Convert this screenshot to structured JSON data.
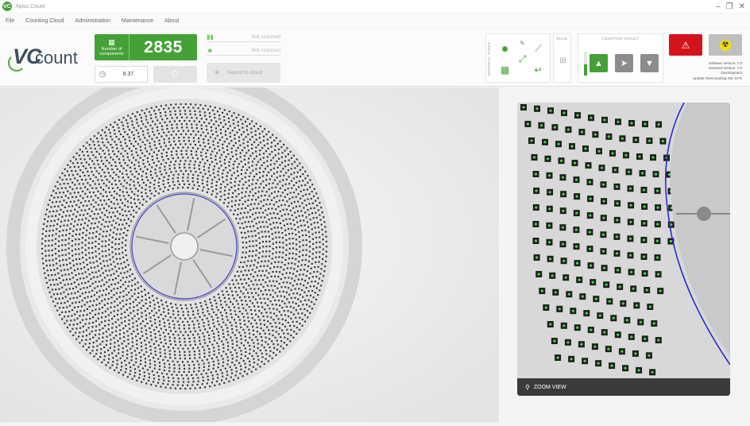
{
  "window": {
    "title": "Xpiss Count",
    "app_icon": "VC",
    "controls": [
      "minimize-icon",
      "restore-icon",
      "close-icon"
    ]
  },
  "menu": [
    "File",
    "Counting Cloud",
    "Administration",
    "Maintenance",
    "About"
  ],
  "logo": {
    "vc": "VC",
    "count": "count"
  },
  "counter": {
    "label": "Number of components",
    "value": "2835",
    "accent": "#43a136"
  },
  "timer": {
    "value": "8.37",
    "icon": "clock-icon"
  },
  "print": {
    "icon": "printer-icon"
  },
  "scan": {
    "barcode_status": "Not scanned",
    "user_status": "Not scanned"
  },
  "report": {
    "label": "Report to cloud",
    "icon": "cloud-share-icon"
  },
  "material_panel": {
    "title": "MATERIAL TYPES"
  },
  "small_panel": {
    "title": "QUAD"
  },
  "results_panel": {
    "title": "COUNTING RESULT"
  },
  "versions": {
    "software": "Software version: 7.0",
    "scanner": "Scanned version: 7.0",
    "dev": "Development",
    "update": "Update Overcounting Set: 67%"
  },
  "zoom_view": {
    "label": "ZOOM VIEW",
    "icon": "search-icon"
  }
}
